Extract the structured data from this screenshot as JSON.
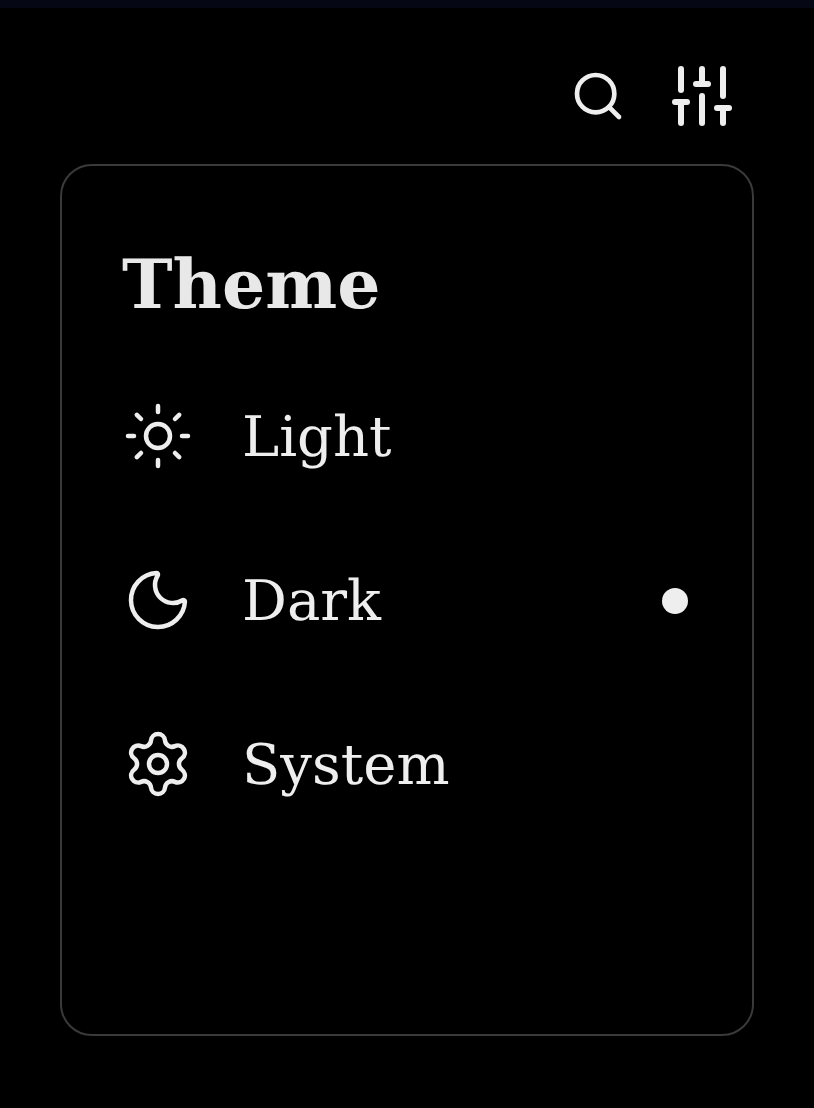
{
  "title": "Theme",
  "options": [
    {
      "kind": "light",
      "label": "Light",
      "selected": false
    },
    {
      "kind": "dark",
      "label": "Dark",
      "selected": true
    },
    {
      "kind": "system",
      "label": "System",
      "selected": false
    }
  ]
}
